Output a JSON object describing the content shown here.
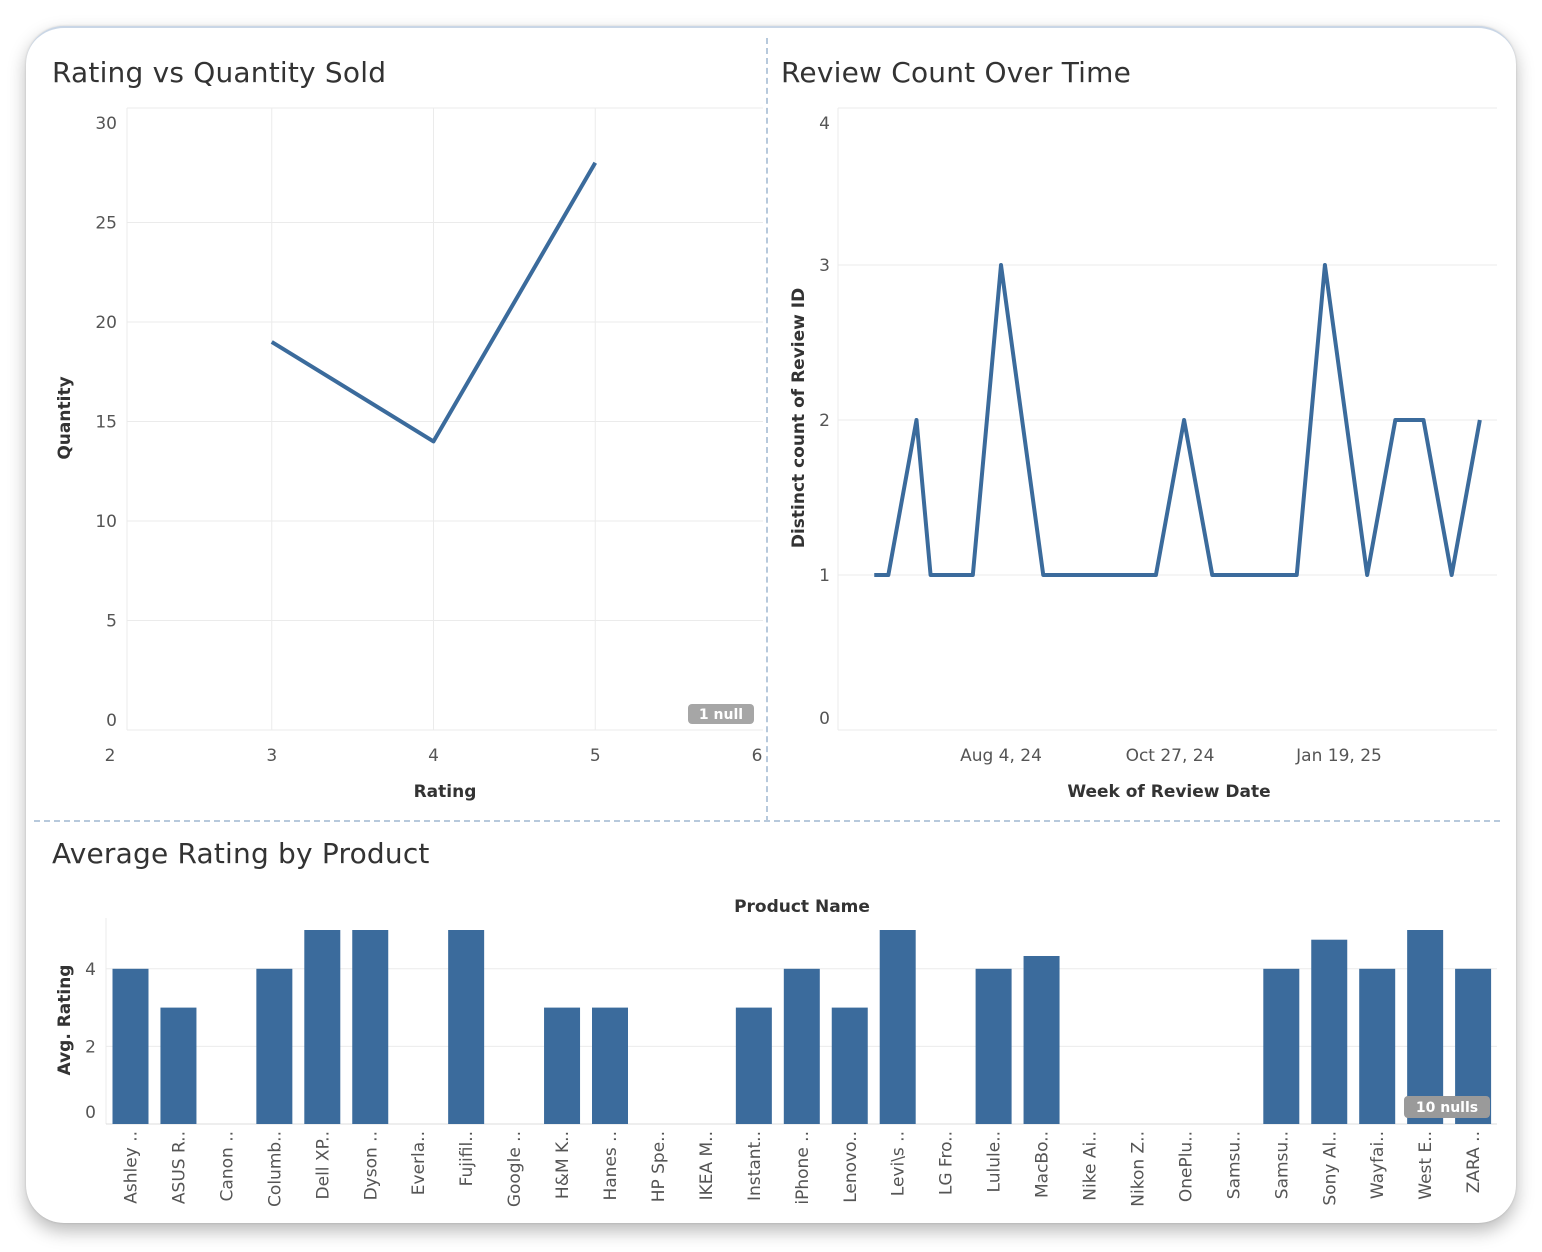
{
  "colors": {
    "series": "#3b6b9c",
    "grid": "#ebebeb",
    "null_badge": "#a6a6a6"
  },
  "chart_data": [
    {
      "type": "line",
      "title": "Rating vs Quantity Sold",
      "xlabel": "Rating",
      "ylabel": "Quantity",
      "xlim": [
        2,
        6
      ],
      "ylim": [
        0,
        30
      ],
      "x_ticks": [
        "2",
        "3",
        "4",
        "5",
        "6"
      ],
      "y_ticks": [
        "0",
        "5",
        "10",
        "15",
        "20",
        "25",
        "30"
      ],
      "x": [
        3,
        4,
        5
      ],
      "y": [
        19,
        14,
        28
      ],
      "grid": true,
      "null_indicator": "1 null"
    },
    {
      "type": "line",
      "title": "Review Count Over Time",
      "xlabel": "Week of Review Date",
      "ylabel": "Distinct count of Review ID",
      "ylim": [
        0,
        4
      ],
      "x_ticks": [
        "Aug 4, 24",
        "Oct 27, 24",
        "Jan 19, 25"
      ],
      "y_ticks": [
        "0",
        "1",
        "2",
        "3",
        "4"
      ],
      "x": [
        "Jun 2, 24",
        "Jun 9, 24",
        "Jun 23, 24",
        "Jun 30, 24",
        "Jul 21, 24",
        "Aug 4, 24",
        "Aug 25, 24",
        "Oct 20, 24",
        "Nov 3, 24",
        "Nov 17, 24",
        "Dec 29, 24",
        "Jan 12, 25",
        "Feb 2, 25",
        "Feb 16, 25",
        "Mar 2, 25",
        "Mar 16, 25",
        "Mar 30, 25"
      ],
      "y": [
        1,
        1,
        2,
        1,
        1,
        3,
        1,
        1,
        2,
        1,
        1,
        3,
        1,
        2,
        2,
        1,
        2
      ],
      "grid": true
    },
    {
      "type": "bar",
      "title": "Average Rating by Product",
      "header": "Product Name",
      "ylabel": "Avg. Rating",
      "ylim": [
        0,
        5
      ],
      "y_ticks": [
        "0",
        "2",
        "4"
      ],
      "categories": [
        "Ashley ..",
        "ASUS R..",
        "Canon ..",
        "Columb..",
        "Dell XP..",
        "Dyson ..",
        "Everla..",
        "Fujifil..",
        "Google ..",
        "H&M K..",
        "Hanes ..",
        "HP Spe..",
        "IKEA M..",
        "Instant..",
        "iPhone ..",
        "Lenovo..",
        "Levi\\s ..",
        "LG Fro..",
        "Lulule..",
        "MacBo..",
        "Nike Ai..",
        "Nikon Z..",
        "OnePlu..",
        "Samsu..",
        "Samsu..",
        "Sony Al..",
        "Wayfai..",
        "West E..",
        "ZARA .."
      ],
      "values": [
        4,
        3,
        null,
        4,
        5,
        5,
        null,
        5,
        null,
        3,
        3,
        null,
        null,
        3,
        4,
        3,
        5,
        null,
        4,
        4.33,
        null,
        null,
        null,
        null,
        4,
        4.75,
        4,
        5,
        4
      ],
      "grid": true,
      "null_indicator": "10 nulls"
    }
  ]
}
